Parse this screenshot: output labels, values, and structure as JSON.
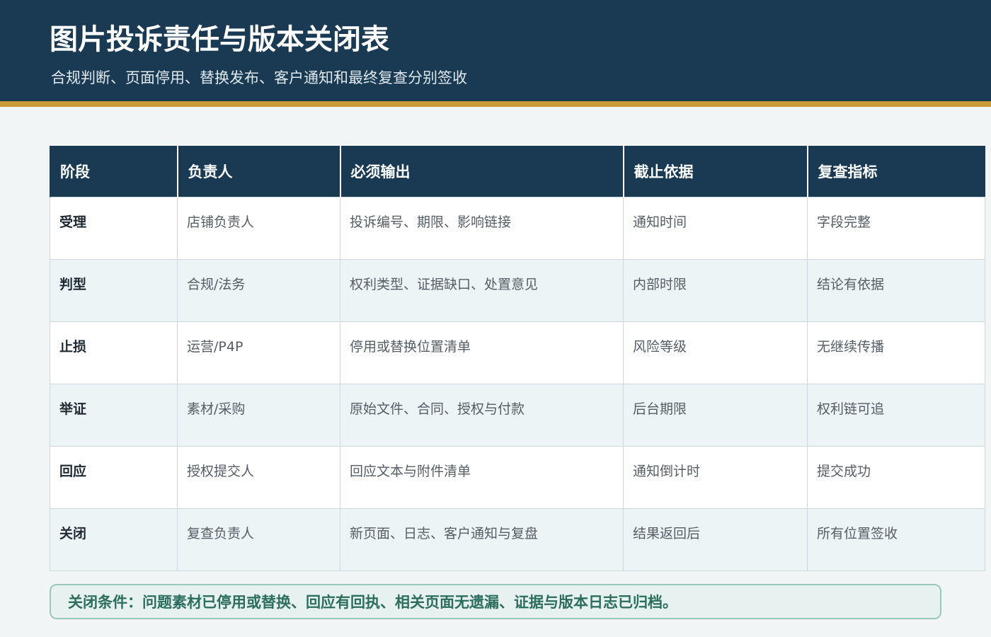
{
  "header": {
    "title": "图片投诉责任与版本关闭表",
    "subtitle": "合规判断、页面停用、替换发布、客户通知和最终复查分别签收"
  },
  "table": {
    "columns": [
      "阶段",
      "负责人",
      "必须输出",
      "截止依据",
      "复查指标"
    ],
    "rows": [
      [
        "受理",
        "店铺负责人",
        "投诉编号、期限、影响链接",
        "通知时间",
        "字段完整"
      ],
      [
        "判型",
        "合规/法务",
        "权利类型、证据缺口、处置意见",
        "内部时限",
        "结论有依据"
      ],
      [
        "止损",
        "运营/P4P",
        "停用或替换位置清单",
        "风险等级",
        "无继续传播"
      ],
      [
        "举证",
        "素材/采购",
        "原始文件、合同、授权与付款",
        "后台期限",
        "权利链可追"
      ],
      [
        "回应",
        "授权提交人",
        "回应文本与附件清单",
        "通知倒计时",
        "提交成功"
      ],
      [
        "关闭",
        "复查负责人",
        "新页面、日志、客户通知与复盘",
        "结果返回后",
        "所有位置签收"
      ]
    ]
  },
  "note": {
    "text": "关闭条件：问题素材已停用或替换、回应有回执、相关页面无遗漏、证据与版本日志已归档。"
  },
  "colors": {
    "header_bg": "#193a52",
    "accent_bar": "#c99a3a",
    "note_text": "#2c6e5d",
    "note_border": "#9bc7bd"
  }
}
